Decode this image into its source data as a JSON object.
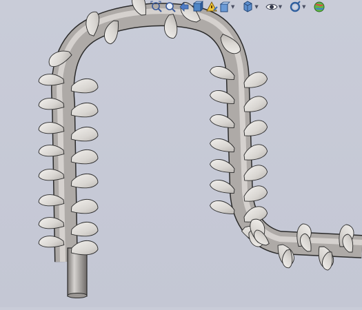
{
  "window": {
    "title": ""
  },
  "viewport": {
    "model": "helical-screw-conveyor-on-bent-shaft",
    "background_top": "#c9ccd8",
    "background_bottom": "#c4c7d4",
    "shaft_color": "#a9a6a3",
    "flight_color": "#e3e0dc",
    "edge_color": "#2a2a2a"
  },
  "heads_up_toolbar": {
    "items": [
      {
        "name": "zoom-to-fit-icon"
      },
      {
        "name": "zoom-to-area-icon"
      },
      {
        "name": "previous-view-icon"
      },
      {
        "name": "section-view-icon"
      },
      {
        "name": "dynamic-annotation-views-icon"
      },
      {
        "name": "view-orientation-icon",
        "has_dropdown": true
      },
      {
        "name": "display-style-icon",
        "has_dropdown": true
      },
      {
        "name": "hide-show-items-icon",
        "has_dropdown": true
      },
      {
        "name": "edit-appearance-icon",
        "has_dropdown": true
      },
      {
        "name": "apply-scene-icon"
      }
    ]
  }
}
